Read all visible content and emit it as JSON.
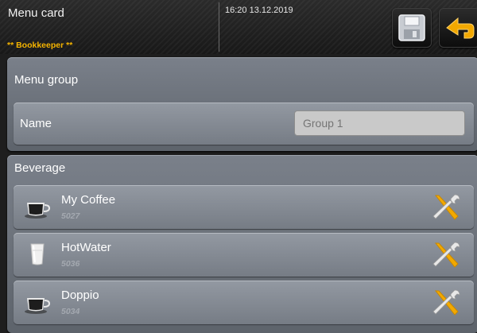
{
  "header": {
    "title": "Menu card",
    "user_role": "** Bookkeeper **",
    "datetime": "16:20 13.12.2019",
    "save_icon": "floppy-disk-icon",
    "back_icon": "back-arrow-icon"
  },
  "menu_group": {
    "title": "Menu group",
    "name_label": "Name",
    "name_value": "",
    "name_placeholder": "Group 1"
  },
  "beverage": {
    "title": "Beverage",
    "items": [
      {
        "name": "My Coffee",
        "code": "5027",
        "icon": "espresso-cup-icon"
      },
      {
        "name": "HotWater",
        "code": "5036",
        "icon": "water-glass-icon"
      },
      {
        "name": "Doppio",
        "code": "5034",
        "icon": "espresso-cup-icon"
      }
    ],
    "edit_icon": "tools-wrench-screwdriver-icon"
  },
  "colors": {
    "accent": "#f5b400",
    "panel": "#6b7179",
    "row": "#8a9099",
    "background": "#1e1e1e"
  }
}
